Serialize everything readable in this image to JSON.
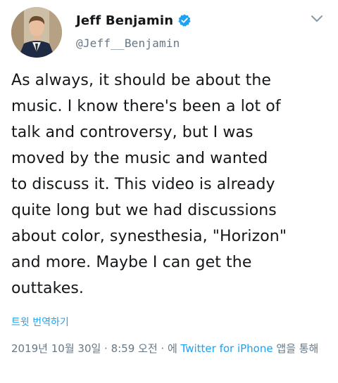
{
  "author": {
    "display_name": "Jeff Benjamin",
    "handle": "@Jeff__Benjamin",
    "verified": true,
    "avatar_icon": "profile-photo"
  },
  "tweet": {
    "text": "As always, it should be about the\nmusic. I know there's been a lot of\ntalk and controversy, but I was\nmoved by the music and wanted\nto discuss it. This video is already\nquite long but we had discussions\nabout color, synesthesia, \"Horizon\"\nand more. Maybe I can get the\nouttakes.",
    "translate_label": "트윗 번역하기"
  },
  "meta": {
    "timestamp": "2019년 10월 30일 · 8:59 오전 · 에",
    "source": "Twitter for iPhone",
    "suffix": "앱을 통해"
  },
  "icons": {
    "verified": "verified-badge-icon",
    "menu": "chevron-down-icon"
  },
  "colors": {
    "link": "#1da1f2",
    "secondary": "#657786",
    "text": "#14171a"
  }
}
